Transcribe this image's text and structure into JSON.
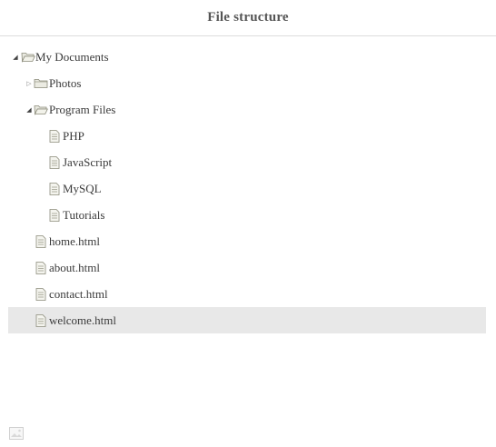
{
  "title": "File structure",
  "tree": {
    "my_documents": {
      "label": "My Documents",
      "expanded": true,
      "icon": "folder-open-icon"
    },
    "photos": {
      "label": "Photos",
      "expanded": false,
      "icon": "folder-icon"
    },
    "program_files": {
      "label": "Program Files",
      "expanded": true,
      "icon": "folder-open-icon"
    },
    "php": {
      "label": "PHP",
      "icon": "file-icon"
    },
    "javascript": {
      "label": "JavaScript",
      "icon": "file-icon"
    },
    "mysql": {
      "label": "MySQL",
      "icon": "file-icon"
    },
    "tutorials": {
      "label": "Tutorials",
      "icon": "file-icon"
    },
    "home": {
      "label": "home.html",
      "icon": "file-icon"
    },
    "about": {
      "label": "about.html",
      "icon": "file-icon"
    },
    "contact": {
      "label": "contact.html",
      "icon": "file-icon"
    },
    "welcome": {
      "label": "welcome.html",
      "icon": "file-icon",
      "selected": true
    }
  },
  "colors": {
    "selected_row": "#e8e8e8",
    "title_border": "#dcdcdc",
    "text": "#3a3a3a"
  }
}
